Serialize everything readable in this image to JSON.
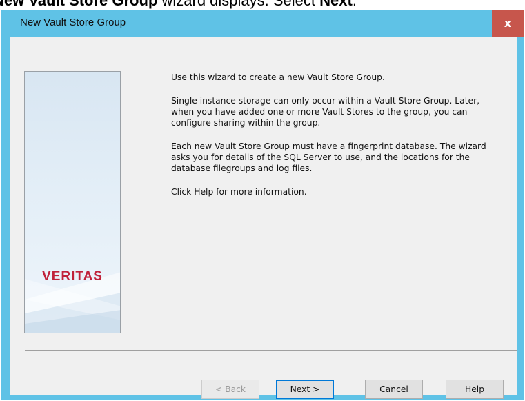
{
  "caption": {
    "part1": "New Vault Store Group",
    "part2": " wizard displays. Select ",
    "part3": "Next",
    "part4": "."
  },
  "window": {
    "title": "New Vault Store Group",
    "close_glyph": "x",
    "titlebar_color": "#5fc2e6",
    "close_color": "#c7564c"
  },
  "side_panel": {
    "logo_text": "VERITAS",
    "logo_color": "#c0213a"
  },
  "content": {
    "paragraphs": [
      "Use this wizard to create a new Vault Store Group.",
      "Single instance storage can only occur within a Vault Store Group. Later, when you have added one or more Vault Stores to the group, you can configure sharing within the group.",
      "Each new Vault Store Group must have a fingerprint database. The wizard asks you for details of the SQL Server to use, and the locations for the database filegroups and log files.",
      "Click Help for more information."
    ]
  },
  "buttons": {
    "back": "< Back",
    "next": "Next >",
    "cancel": "Cancel",
    "help": "Help"
  }
}
